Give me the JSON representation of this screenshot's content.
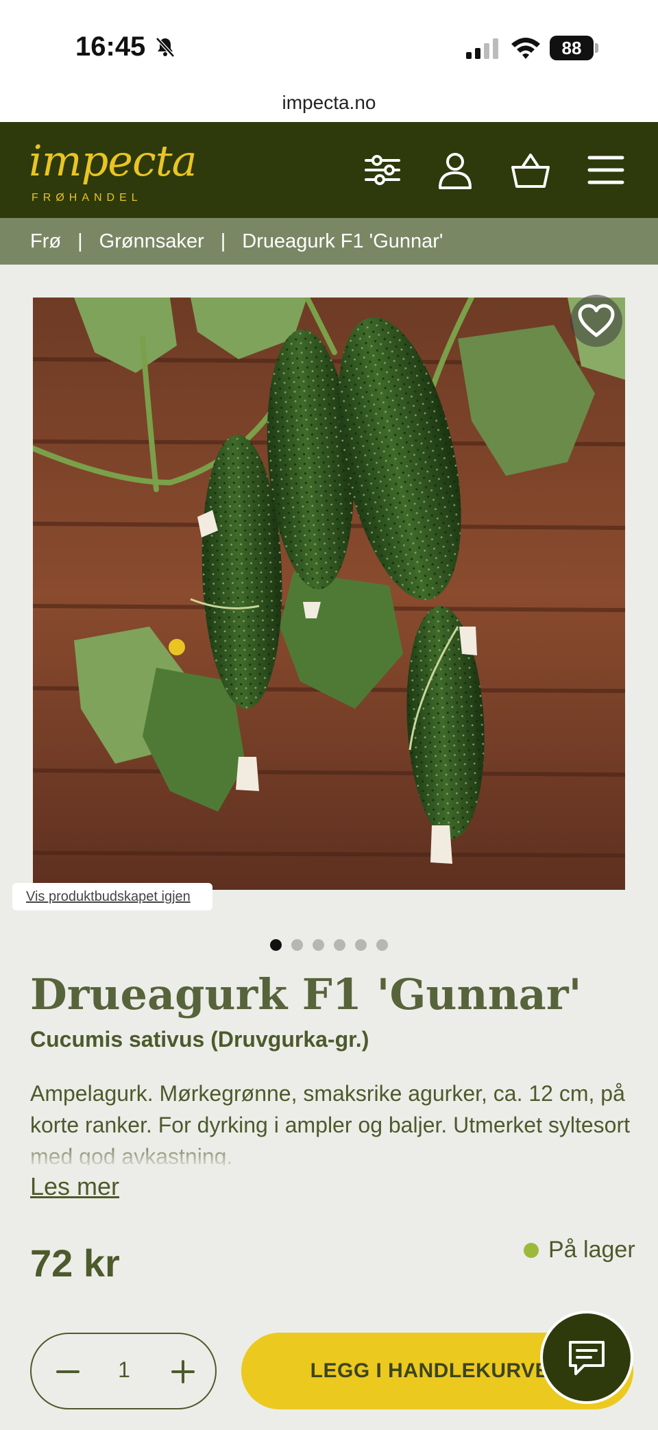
{
  "status_bar": {
    "time": "16:45",
    "battery": "88"
  },
  "browser": {
    "url": "impecta.no"
  },
  "header": {
    "logo_text": "impecta",
    "logo_subtext": "FRØHANDEL"
  },
  "breadcrumb": {
    "items": [
      "Frø",
      "Grønnsaker",
      "Drueagurk F1 'Gunnar'"
    ],
    "separator": "|"
  },
  "gallery": {
    "reshow_label": "Vis produktbudskapet igjen",
    "dot_count": 6,
    "active_index": 0
  },
  "product": {
    "title": "Drueagurk F1 'Gunnar'",
    "latin_name": "Cucumis sativus (Druvgurka-gr.)",
    "description": "Ampelagurk. Mørkegrønne, smaksrike agurker, ca. 12 cm, på korte ranker. For dyrking i ampler og baljer. Utmerket syltesort med god avkastning.",
    "read_more": "Les mer",
    "price": "72 kr",
    "stock_status": "På lager",
    "stock_color": "#9cb93a"
  },
  "cart": {
    "quantity": "1",
    "add_label": "LEGG I HANDLEKURVEN"
  },
  "colors": {
    "header_bg": "#2e3a0c",
    "breadcrumb_bg": "#7a8764",
    "accent_yellow": "#ecc91f",
    "text_olive": "#4d5a2c"
  }
}
